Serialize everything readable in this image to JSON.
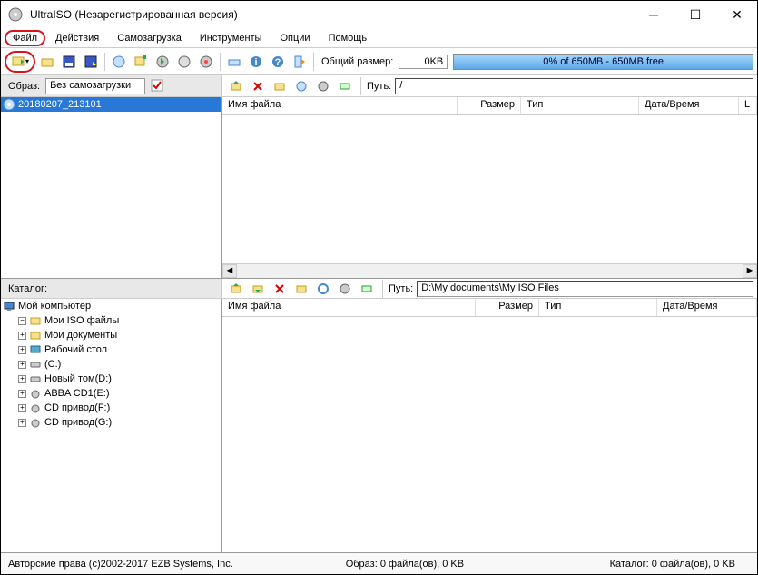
{
  "title": "UltraISO (Незарегистрированная версия)",
  "menu": [
    "Файл",
    "Действия",
    "Самозагрузка",
    "Инструменты",
    "Опции",
    "Помощь"
  ],
  "size_label": "Общий размер:",
  "size_value": "0KB",
  "progress_text": "0% of 650MB - 650MB free",
  "image_label": "Образ:",
  "image_boot": "Без самозагрузки",
  "path_label_1": "Путь:",
  "path_value_1": "/",
  "path_label_2": "Путь:",
  "path_value_2": "D:\\My documents\\My ISO Files",
  "catalog_label": "Каталог:",
  "tree1_root": "20180207_213101",
  "cols": {
    "name": "Имя файла",
    "size": "Размер",
    "type": "Тип",
    "date": "Дата/Время",
    "l": "L"
  },
  "tree2": [
    "Мой компьютер",
    "Мои ISO файлы",
    "Мои документы",
    "Рабочий стол",
    "(C:)",
    "Новый том(D:)",
    "ABBA CD1(E:)",
    "CD привод(F:)",
    "CD привод(G:)"
  ],
  "status": {
    "copyright": "Авторские права (c)2002-2017 EZB Systems, Inc.",
    "image": "Образ: 0 файла(ов), 0 KB",
    "catalog": "Каталог: 0 файла(ов), 0 KB"
  }
}
